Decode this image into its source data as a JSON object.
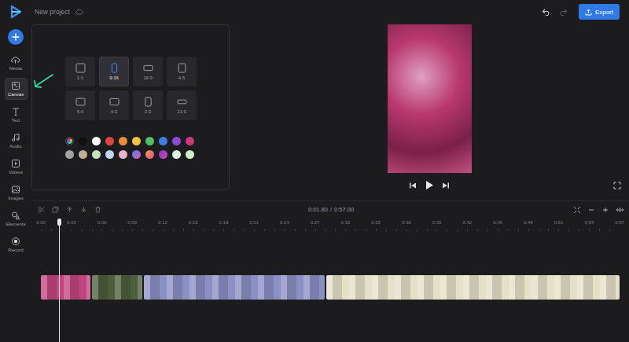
{
  "header": {
    "title": "New project",
    "export": "Export"
  },
  "sidebar": {
    "items": [
      {
        "label": "Media",
        "selected": false
      },
      {
        "label": "Canvas",
        "selected": true
      },
      {
        "label": "Text",
        "selected": false
      },
      {
        "label": "Audio",
        "selected": false
      },
      {
        "label": "Videos",
        "selected": false
      },
      {
        "label": "Images",
        "selected": false
      },
      {
        "label": "Elements",
        "selected": false
      },
      {
        "label": "Record",
        "selected": false
      }
    ]
  },
  "canvas": {
    "ratios": [
      {
        "label": "1:1",
        "selected": false
      },
      {
        "label": "9:16",
        "selected": true
      },
      {
        "label": "16:9",
        "selected": false
      },
      {
        "label": "4:5",
        "selected": false
      },
      {
        "label": "5:4",
        "selected": false
      },
      {
        "label": "4:3",
        "selected": false
      },
      {
        "label": "2:3",
        "selected": false
      },
      {
        "label": "21:9",
        "selected": false
      }
    ],
    "swatches": [
      {
        "kind": "picker"
      },
      {
        "kind": "solid",
        "color": "#111111"
      },
      {
        "kind": "solid",
        "color": "#ffffff"
      },
      {
        "kind": "solid",
        "color": "#e0463f"
      },
      {
        "kind": "solid",
        "color": "#ec8a3c"
      },
      {
        "kind": "solid",
        "color": "#f2c443"
      },
      {
        "kind": "solid",
        "color": "#4fbf63"
      },
      {
        "kind": "solid",
        "color": "#3d7fe0"
      },
      {
        "kind": "solid",
        "color": "#8a4ad6"
      },
      {
        "kind": "solid",
        "color": "#c8397d"
      },
      {
        "kind": "solid",
        "color": "#a3a3a6"
      },
      {
        "kind": "solid",
        "color": "#bfae93"
      },
      {
        "kind": "solid",
        "color": "#c4e3bd"
      },
      {
        "kind": "solid",
        "color": "#bdd6f2"
      },
      {
        "kind": "solid",
        "color": "#e6b3cc"
      },
      {
        "kind": "gradient",
        "colors": [
          "#5b7cf0",
          "#e05ab0"
        ]
      },
      {
        "kind": "gradient",
        "colors": [
          "#f0a050",
          "#e04a8a"
        ]
      },
      {
        "kind": "gradient",
        "colors": [
          "#7a3ad0",
          "#d04ab0"
        ]
      },
      {
        "kind": "gradient",
        "colors": [
          "#c8f0e0",
          "#f0f8e8"
        ]
      },
      {
        "kind": "gradient",
        "colors": [
          "#bfe8c8",
          "#e8f4c0"
        ]
      }
    ]
  },
  "player": {
    "time": "0:01.80",
    "separator": "/",
    "duration": "0:57.00"
  },
  "timeline": {
    "ruler": [
      "0:00",
      "0:03",
      "0:06",
      "0:09",
      "0:12",
      "0:15",
      "0:18",
      "0:21",
      "0:24",
      "0:27",
      "0:30",
      "0:33",
      "0:36",
      "0:39",
      "0:42",
      "0:45",
      "0:48",
      "0:51",
      "0:54",
      "0:57"
    ],
    "playhead": {
      "level": 0.0316
    },
    "clips": [
      {
        "level": 0.086,
        "color": "#c2457f"
      },
      {
        "level": 0.086,
        "color": "#4d5e3c"
      },
      {
        "level": 0.3125,
        "color": "#8a8fc4"
      },
      {
        "level": 0.507,
        "color": "#e6e0c8"
      }
    ]
  }
}
